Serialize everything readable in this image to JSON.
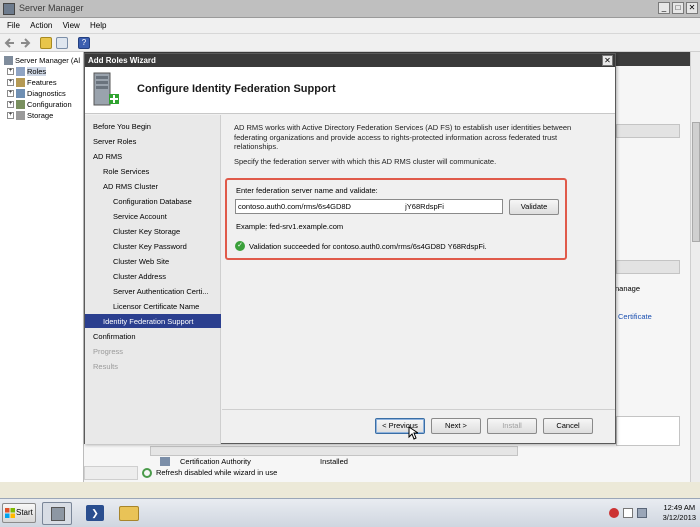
{
  "server_manager": {
    "title": "Server Manager",
    "menu": [
      "File",
      "Action",
      "View",
      "Help"
    ],
    "tree": [
      {
        "label": "Server Manager (Al",
        "level": 0,
        "expander": ""
      },
      {
        "label": "Roles",
        "level": 1,
        "expander": "+"
      },
      {
        "label": "Features",
        "level": 1,
        "expander": "+"
      },
      {
        "label": "Diagnostics",
        "level": 1,
        "expander": "+"
      },
      {
        "label": "Configuration",
        "level": 1,
        "expander": "+"
      },
      {
        "label": "Storage",
        "level": 1,
        "expander": "+"
      }
    ],
    "background_text": {
      "manage": "nanage",
      "certificate_link": "Certificate",
      "row_role": "Certification Authority",
      "row_status": "Installed",
      "refresh_notice": "Refresh disabled while wizard in use"
    }
  },
  "wizard": {
    "title": "Add Roles Wizard",
    "heading": "Configure Identity Federation Support",
    "nav": [
      {
        "label": "Before You Begin",
        "indent": 0,
        "state": "normal"
      },
      {
        "label": "Server Roles",
        "indent": 0,
        "state": "normal"
      },
      {
        "label": "AD RMS",
        "indent": 0,
        "state": "normal"
      },
      {
        "label": "Role Services",
        "indent": 1,
        "state": "normal"
      },
      {
        "label": "AD RMS Cluster",
        "indent": 1,
        "state": "normal"
      },
      {
        "label": "Configuration Database",
        "indent": 2,
        "state": "normal"
      },
      {
        "label": "Service Account",
        "indent": 2,
        "state": "normal"
      },
      {
        "label": "Cluster Key Storage",
        "indent": 2,
        "state": "normal"
      },
      {
        "label": "Cluster Key Password",
        "indent": 2,
        "state": "normal"
      },
      {
        "label": "Cluster Web Site",
        "indent": 2,
        "state": "normal"
      },
      {
        "label": "Cluster Address",
        "indent": 2,
        "state": "normal"
      },
      {
        "label": "Server Authentication Certi...",
        "indent": 2,
        "state": "normal"
      },
      {
        "label": "Licensor Certificate Name",
        "indent": 2,
        "state": "normal"
      },
      {
        "label": "Identity Federation Support",
        "indent": 1,
        "state": "selected"
      },
      {
        "label": "Confirmation",
        "indent": 0,
        "state": "normal"
      },
      {
        "label": "Progress",
        "indent": 0,
        "state": "disabled"
      },
      {
        "label": "Results",
        "indent": 0,
        "state": "disabled"
      }
    ],
    "description": "AD RMS works with Active Directory Federation Services (AD FS) to establish user identities between federating organizations and provide access to rights-protected information across federated trust relationships.",
    "instruction": "Specify the federation server with which this AD RMS cluster will communicate.",
    "field_label": "Enter federation server name and validate:",
    "field_value": "contoso.auth0.com/rms/6s4GD8D                          jY68RdspFi",
    "validate_label": "Validate",
    "example": "Example: fed-srv1.example.com",
    "success_message": "Validation succeeded for contoso.auth0.com/rms/6s4GD8D                         Y68RdspFi.",
    "buttons": {
      "previous": "< Previous",
      "next": "Next >",
      "install": "Install",
      "cancel": "Cancel"
    }
  },
  "taskbar": {
    "start_label": "Start",
    "time": "12:49 AM",
    "date": "3/12/2013"
  },
  "colors": {
    "highlight_border": "#e05a4a",
    "nav_selected": "#2b3f8f",
    "success": "#3aa03a"
  }
}
